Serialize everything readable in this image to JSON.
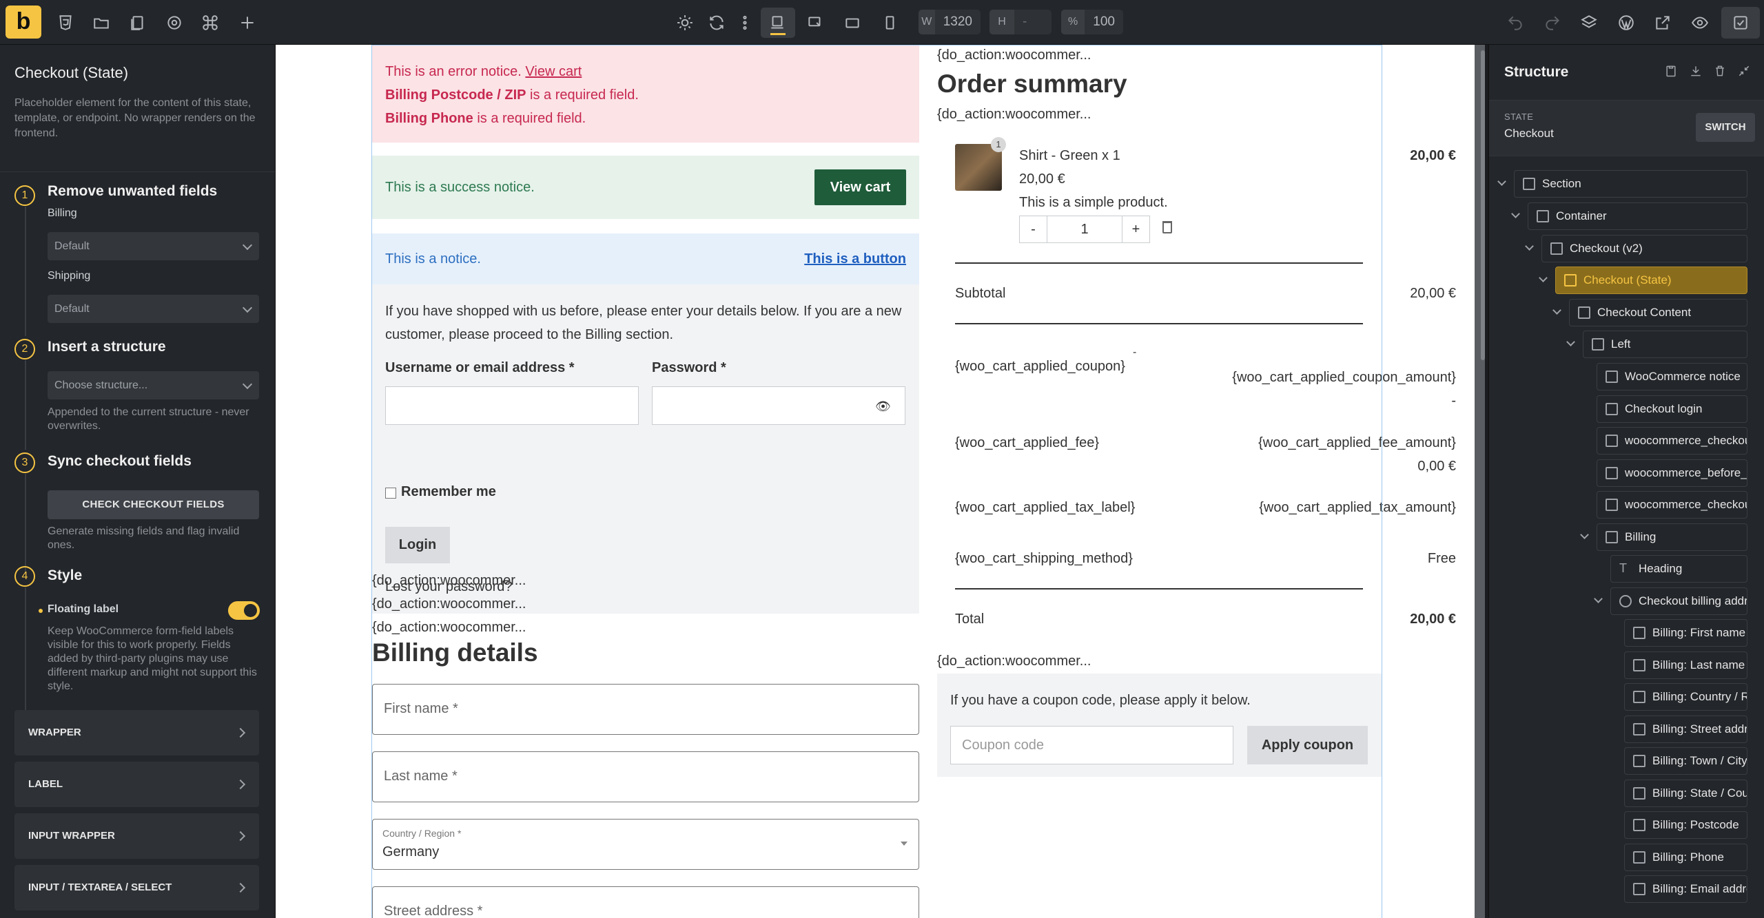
{
  "toolbar": {
    "logo": "b",
    "width_key": "W",
    "width_value": "1320",
    "height_key": "H",
    "height_value": "-",
    "zoom_key": "%",
    "zoom_value": "100"
  },
  "left_panel": {
    "title": "Checkout (State)",
    "description": "Placeholder element for the content of this state, template, or endpoint. No wrapper renders on the frontend.",
    "steps": [
      {
        "num": "1",
        "title": "Remove unwanted fields"
      },
      {
        "num": "2",
        "title": "Insert a structure"
      },
      {
        "num": "3",
        "title": "Sync checkout fields"
      },
      {
        "num": "4",
        "title": "Style"
      }
    ],
    "billing_label": "Billing",
    "billing_value": "Default",
    "shipping_label": "Shipping",
    "shipping_value": "Default",
    "structure_placeholder": "Choose structure...",
    "structure_hint": "Appended to the current structure - never overwrites.",
    "check_button": "CHECK CHECKOUT FIELDS",
    "check_hint": "Generate missing fields and flag invalid ones.",
    "floating_label": "Floating label",
    "floating_enabled": true,
    "floating_hint": "Keep WooCommerce form-field labels visible for this to work properly. Fields added by third-party plugins may use different markup and might not support this style.",
    "accordions": [
      "WRAPPER",
      "LABEL",
      "INPUT WRAPPER",
      "INPUT / TEXTAREA / SELECT"
    ]
  },
  "canvas": {
    "error_notice": {
      "line1": "This is an error notice.",
      "link": "View cart",
      "field1": "Billing Postcode / ZIP",
      "field2": "Billing Phone",
      "required": "is a required field."
    },
    "success_notice": {
      "text": "This is a success notice.",
      "button": "View cart"
    },
    "info_notice": {
      "text": "This is a notice.",
      "link": "This is a button"
    },
    "login": {
      "intro": "If you have shopped with us before, please enter your details below. If you are a new customer, please proceed to the Billing section.",
      "username_label": "Username or email address *",
      "password_label": "Password *",
      "remember": "Remember me",
      "login_button": "Login",
      "lost": "Lost your password?"
    },
    "hook": "{do_action:woocommer...",
    "billing_title": "Billing details",
    "billing_fields": {
      "first_name": "First name *",
      "last_name": "Last name *",
      "country_label": "Country / Region *",
      "country_value": "Germany",
      "street": "Street address *"
    },
    "order": {
      "title": "Order summary",
      "product_qty_badge": "1",
      "product_name": "Shirt - Green x 1",
      "product_price": "20,00 €",
      "product_line_price": "20,00 €",
      "product_desc": "This is a simple product.",
      "minus": "-",
      "qty": "1",
      "plus": "+",
      "subtotal_label": "Subtotal",
      "subtotal_value": "20,00 €",
      "coupon_label": "{woo_cart_applied_coupon}",
      "coupon_dash": "-",
      "coupon_amount": "{woo_cart_applied_coupon_amount}",
      "coupon_dash2": "-",
      "fee_label": "{woo_cart_applied_fee}",
      "fee_amount": "{woo_cart_applied_fee_amount}",
      "fee_value": "0,00 €",
      "tax_label": "{woo_cart_applied_tax_label}",
      "tax_amount": "{woo_cart_applied_tax_amount}",
      "shipping_label": "{woo_cart_shipping_method}",
      "shipping_value": "Free",
      "total_label": "Total",
      "total_value": "20,00 €"
    },
    "coupon": {
      "text": "If you have a coupon code, please apply it below.",
      "placeholder": "Coupon code",
      "button": "Apply coupon"
    }
  },
  "right_panel": {
    "title": "Structure",
    "state_key": "STATE",
    "state_value": "Checkout",
    "switch": "SWITCH",
    "tree": [
      "Section",
      "Container",
      "Checkout (v2)",
      "Checkout (State)",
      "Checkout Content",
      "Left",
      "WooCommerce notice",
      "Checkout login",
      "woocommerce_checkout_before_customer_details",
      "woocommerce_before_checkout_billing_form",
      "woocommerce_checkout_billing",
      "Billing",
      "Heading",
      "Checkout billing address",
      "Billing: First name",
      "Billing: Last name",
      "Billing: Country / Region",
      "Billing: Street address",
      "Billing: Town / City",
      "Billing: State / County",
      "Billing: Postcode",
      "Billing: Phone",
      "Billing: Email address"
    ]
  },
  "colors": {
    "accent": "#f5c443",
    "panel": "#23262a",
    "error_bg": "#fbe3e6",
    "success_bg": "#e6f2ea",
    "info_bg": "#e6f0fb"
  }
}
